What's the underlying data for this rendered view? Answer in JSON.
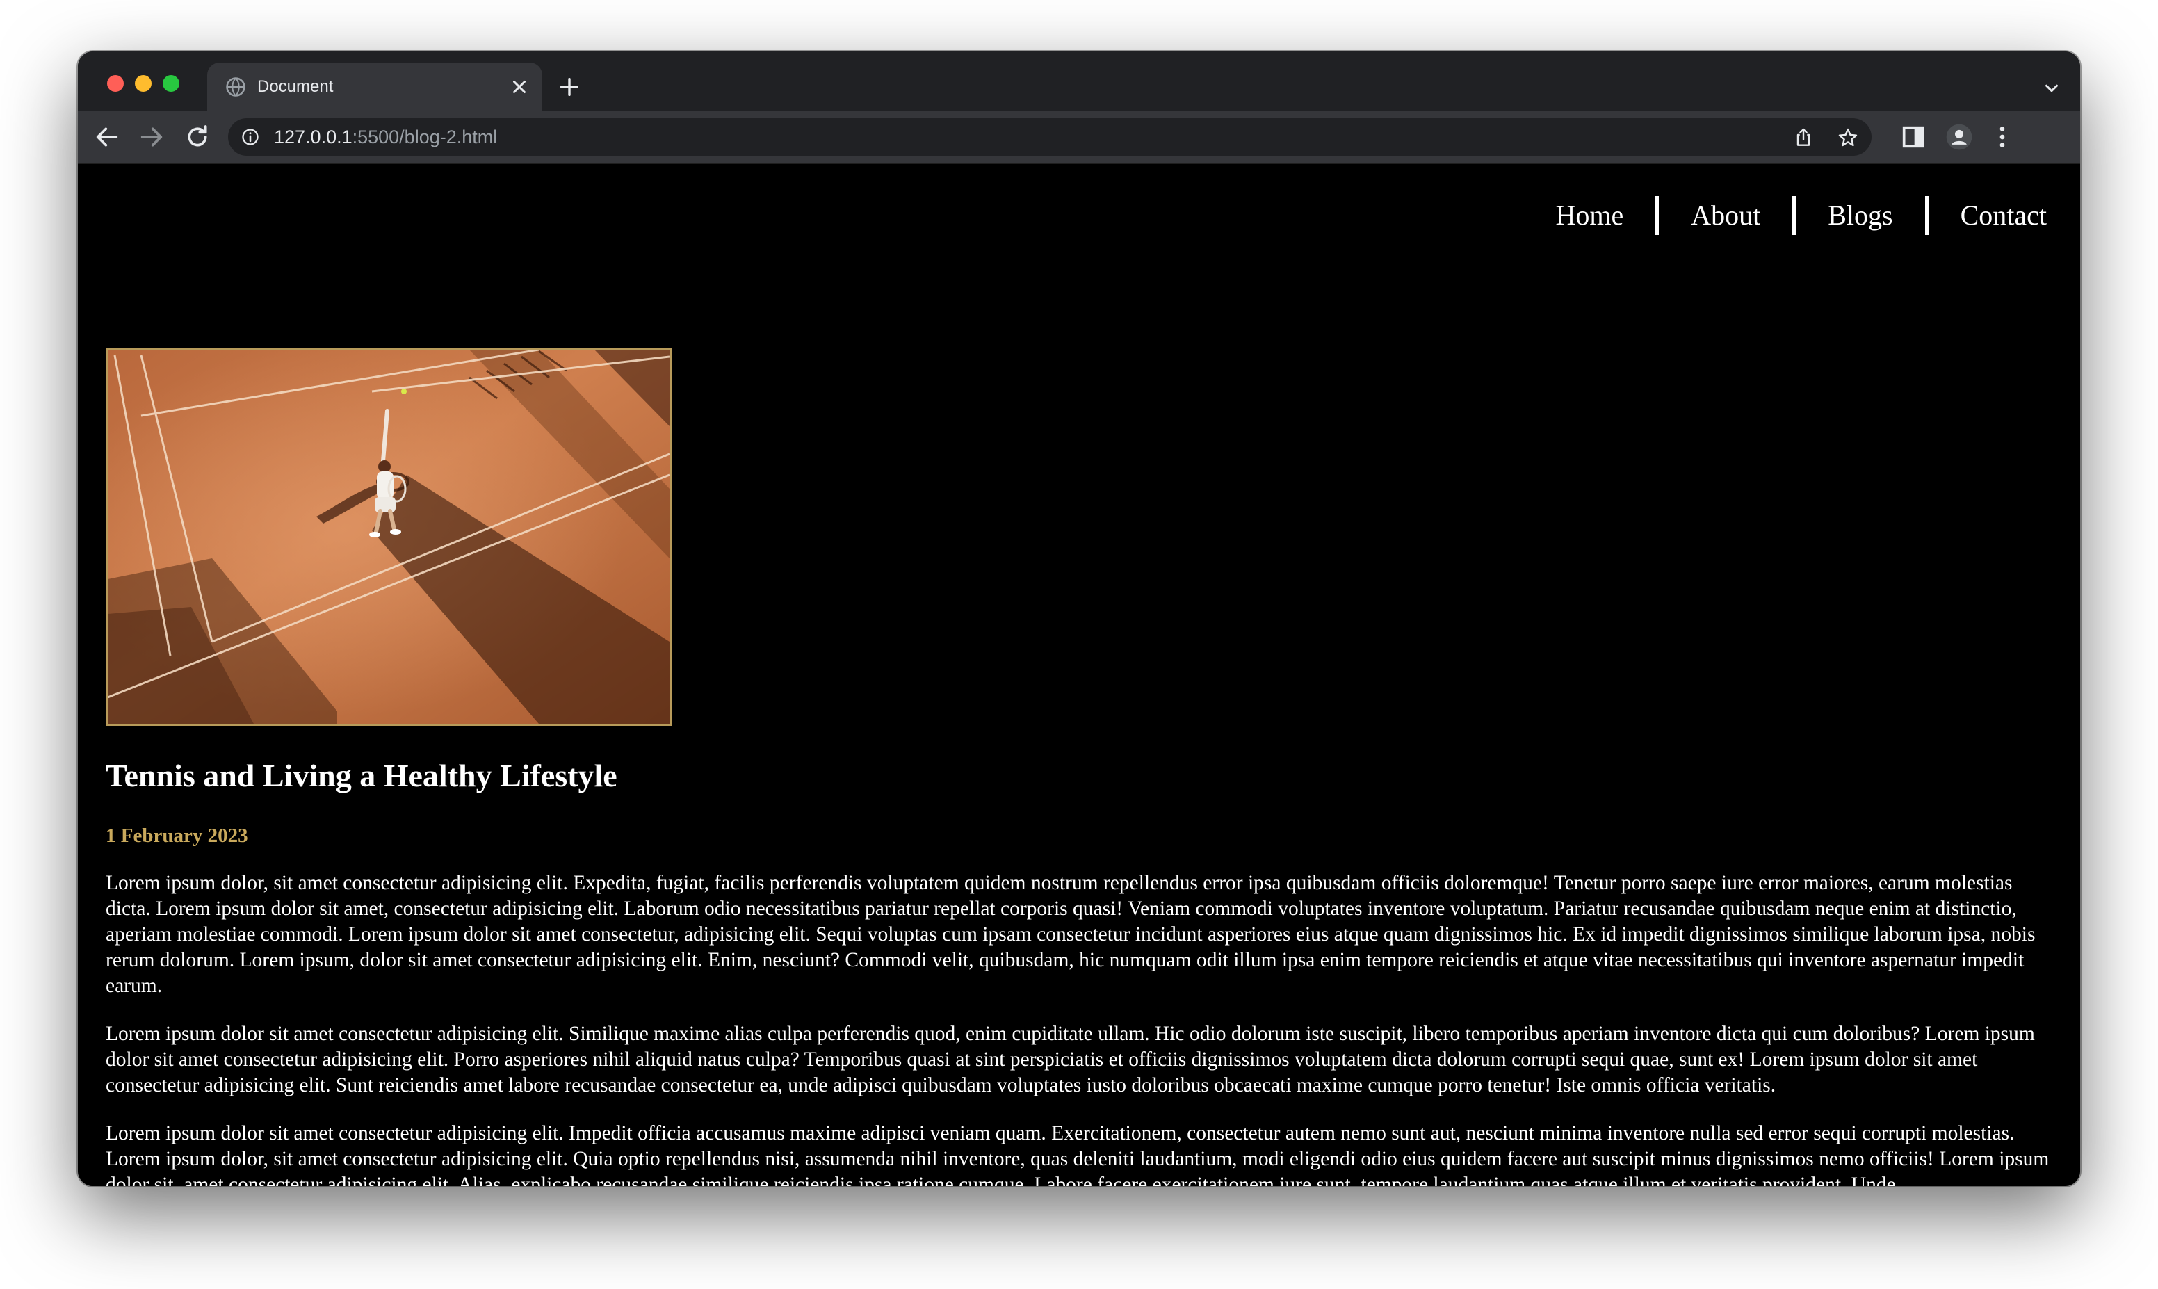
{
  "browser": {
    "tab_title": "Document",
    "url_host": "127.0.0.1",
    "url_rest": ":5500/blog-2.html"
  },
  "site_nav": {
    "links": [
      "Home",
      "About",
      "Blogs",
      "Contact"
    ]
  },
  "post": {
    "title": "Tennis and Living a Healthy Lifestyle",
    "date": "1 February 2023",
    "image_subject": "tennis player serving on a clay court",
    "paragraphs": [
      "Lorem ipsum dolor, sit amet consectetur adipisicing elit. Expedita, fugiat, facilis perferendis voluptatem quidem nostrum repellendus error ipsa quibusdam officiis doloremque! Tenetur porro saepe iure error maiores, earum molestias dicta. Lorem ipsum dolor sit amet, consectetur adipisicing elit. Laborum odio necessitatibus pariatur repellat corporis quasi! Veniam commodi voluptates inventore voluptatum. Pariatur recusandae quibusdam neque enim at distinctio, aperiam molestiae commodi. Lorem ipsum dolor sit amet consectetur, adipisicing elit. Sequi voluptas cum ipsam consectetur incidunt asperiores eius atque quam dignissimos hic. Ex id impedit dignissimos similique laborum ipsa, nobis rerum dolorum. Lorem ipsum, dolor sit amet consectetur adipisicing elit. Enim, nesciunt? Commodi velit, quibusdam, hic numquam odit illum ipsa enim tempore reiciendis et atque vitae necessitatibus qui inventore aspernatur impedit earum.",
      "Lorem ipsum dolor sit amet consectetur adipisicing elit. Similique maxime alias culpa perferendis quod, enim cupiditate ullam. Hic odio dolorum iste suscipit, libero temporibus aperiam inventore dicta qui cum doloribus? Lorem ipsum dolor sit amet consectetur adipisicing elit. Porro asperiores nihil aliquid natus culpa? Temporibus quasi at sint perspiciatis et officiis dignissimos voluptatem dicta dolorum corrupti sequi quae, sunt ex! Lorem ipsum dolor sit amet consectetur adipisicing elit. Sunt reiciendis amet labore recusandae consectetur ea, unde adipisci quibusdam voluptates iusto doloribus obcaecati maxime cumque porro tenetur! Iste omnis officia veritatis.",
      "Lorem ipsum dolor sit amet consectetur adipisicing elit. Impedit officia accusamus maxime adipisci veniam quam. Exercitationem, consectetur autem nemo sunt aut, nesciunt minima inventore nulla sed error sequi corrupti molestias. Lorem ipsum dolor, sit amet consectetur adipisicing elit. Quia optio repellendus nisi, assumenda nihil inventore, quas deleniti laudantium, modi eligendi odio eius quidem facere aut suscipit minus dignissimos nemo officiis! Lorem ipsum dolor sit, amet consectetur adipisicing elit. Alias, explicabo recusandae similique reiciendis ipsa ratione cumque. Labore facere exercitationem iure sunt, tempore laudantium quas atque illum et veritatis provident. Unde"
    ]
  },
  "colors": {
    "page_background": "#000000",
    "accent_gold": "#c9a95c",
    "image_border": "#b89b5a",
    "chrome_dark": "#202124",
    "chrome_mid": "#35363a"
  },
  "icons": {
    "tab_favicon": "globe-icon",
    "tab_close": "close-icon",
    "new_tab": "plus-icon",
    "tab_search": "chevron-down-icon",
    "back": "arrow-left-icon",
    "forward": "arrow-right-icon",
    "reload": "reload-icon",
    "site_info": "info-icon",
    "share": "share-icon",
    "bookmark": "star-icon",
    "side_panel": "side-panel-icon",
    "profile": "profile-icon",
    "menu": "kebab-menu-icon"
  }
}
